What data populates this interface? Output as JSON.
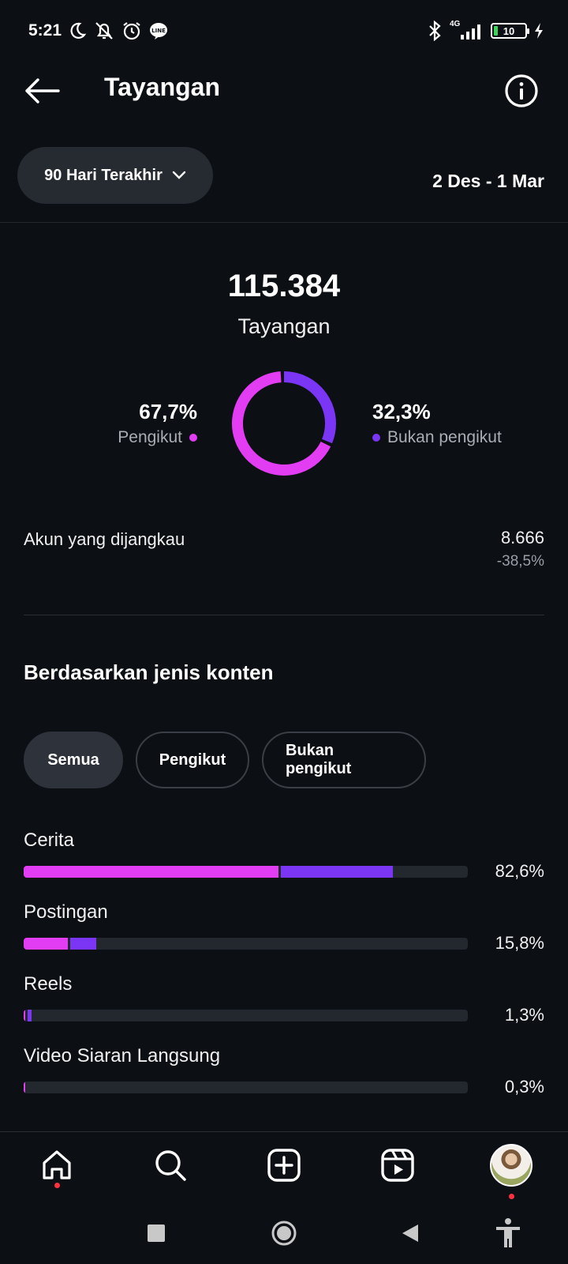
{
  "status_bar": {
    "time": "5:21",
    "network": "4G",
    "battery": "10"
  },
  "header": {
    "title": "Tayangan"
  },
  "filters": {
    "range_label": "90 Hari Terakhir",
    "date_range": "2 Des - 1 Mar"
  },
  "summary": {
    "total_value": "115.384",
    "total_label": "Tayangan",
    "followers": {
      "percent": "67,7%",
      "label": "Pengikut",
      "value": 67.7
    },
    "non_followers": {
      "percent": "32,3%",
      "label": "Bukan pengikut",
      "value": 32.3
    }
  },
  "reach": {
    "label": "Akun yang dijangkau",
    "value": "8.666",
    "change": "-38,5%"
  },
  "content_type": {
    "title": "Berdasarkan jenis konten",
    "tabs": [
      "Semua",
      "Pengikut",
      "Bukan pengikut"
    ],
    "active_tab": "Semua",
    "rows": [
      {
        "label": "Cerita",
        "percent": "82,6%",
        "follower_share": 0.573,
        "nonfollower_share": 0.253
      },
      {
        "label": "Postingan",
        "percent": "15,8%",
        "follower_share": 0.1,
        "nonfollower_share": 0.058
      },
      {
        "label": "Reels",
        "percent": "1,3%",
        "follower_share": 0.004,
        "nonfollower_share": 0.009
      },
      {
        "label": "Video Siaran Langsung",
        "percent": "0,3%",
        "follower_share": 0.003,
        "nonfollower_share": 0.0
      }
    ]
  },
  "colors": {
    "follower": "#e23df3",
    "non_follower": "#7a35f5",
    "background": "#0c0f14"
  },
  "bottom_nav": [
    "home-icon",
    "search-icon",
    "create-icon",
    "reels-icon",
    "profile-avatar"
  ],
  "system_nav": [
    "recents-icon",
    "home-circle-icon",
    "back-triangle-icon",
    "accessibility-icon"
  ]
}
